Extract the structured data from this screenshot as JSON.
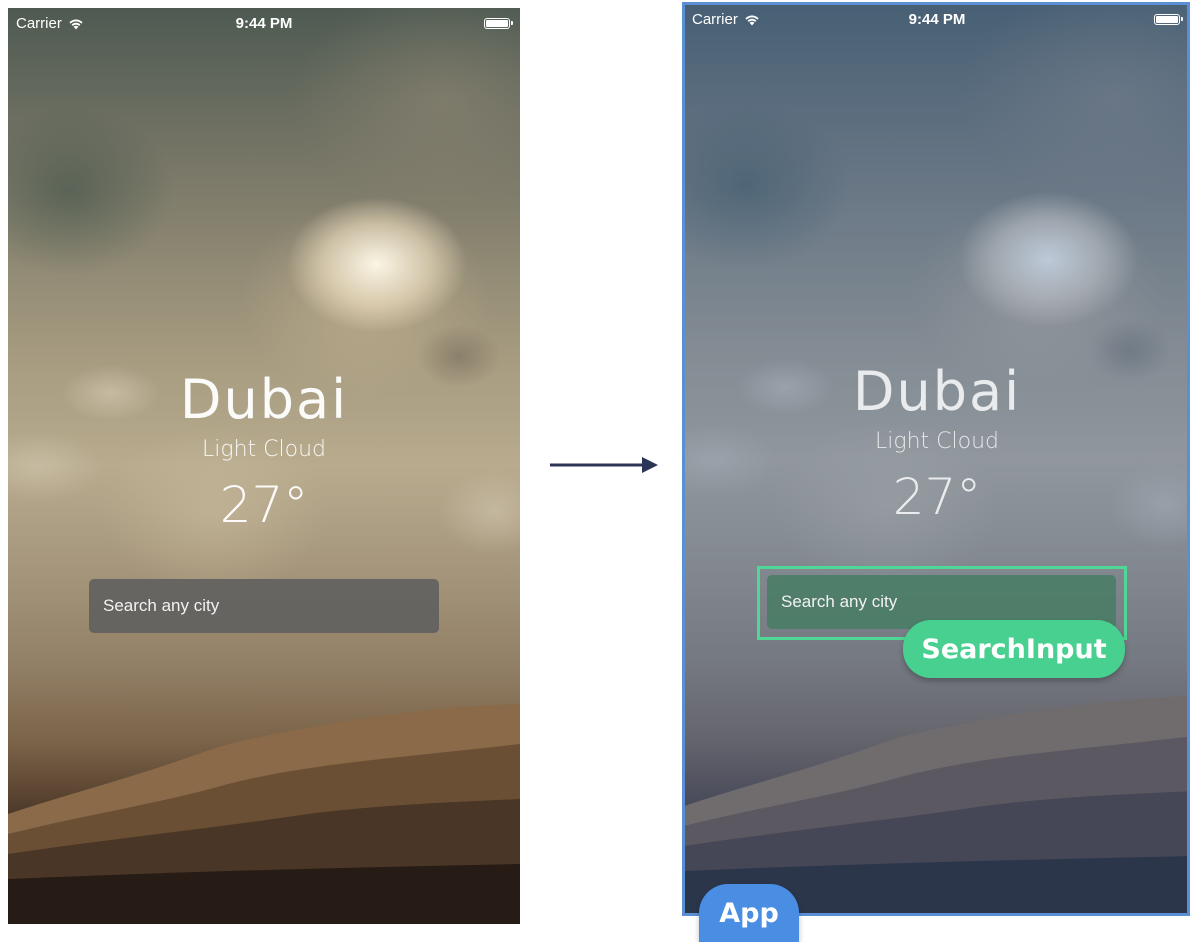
{
  "status_bar": {
    "carrier": "Carrier",
    "time": "9:44 PM"
  },
  "weather": {
    "city": "Dubai",
    "condition": "Light Cloud",
    "temperature": "27°"
  },
  "search": {
    "placeholder": "Search any city",
    "value": ""
  },
  "annotations": {
    "search_label": "SearchInput",
    "app_label": "App",
    "search_color": "#47d08f",
    "app_color": "#4a8ee4"
  },
  "icons": [
    "wifi-icon",
    "battery-icon",
    "arrow-right-icon"
  ]
}
